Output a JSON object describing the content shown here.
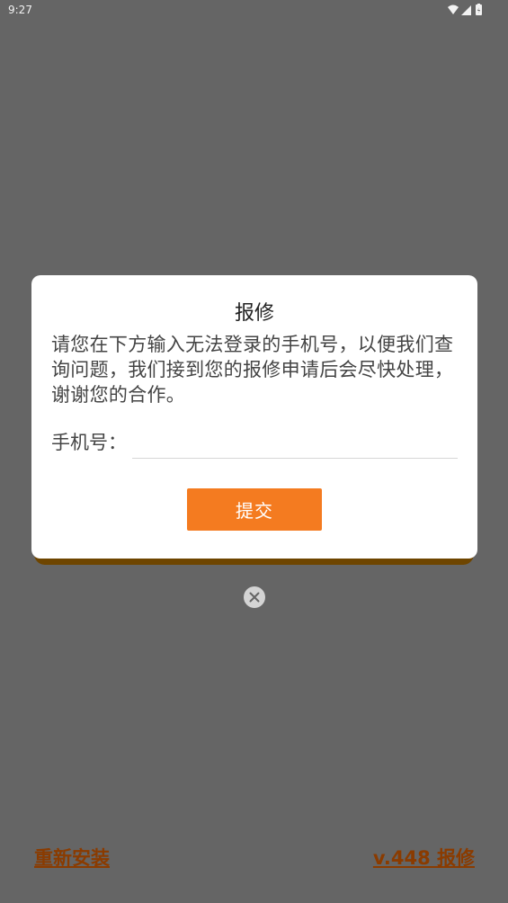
{
  "status_bar": {
    "time": "9:27"
  },
  "dialog": {
    "title": "报修",
    "message": "请您在下方输入无法登录的手机号，以便我们查询问题，我们接到您的报修申请后会尽快处理，谢谢您的合作。",
    "phone_label": "手机号：",
    "phone_value": "",
    "submit_label": "提交"
  },
  "footer": {
    "reinstall_label": "重新安装",
    "version_repair_label": "v.448 报修"
  },
  "icons": {
    "status": [
      "wifi-icon",
      "signal-icon",
      "battery-icon"
    ],
    "close": "close-icon",
    "logo": "app-logo"
  },
  "colors": {
    "accent": "#f47b20",
    "footer_link": "#8a3b00",
    "scrim": "#656565"
  }
}
